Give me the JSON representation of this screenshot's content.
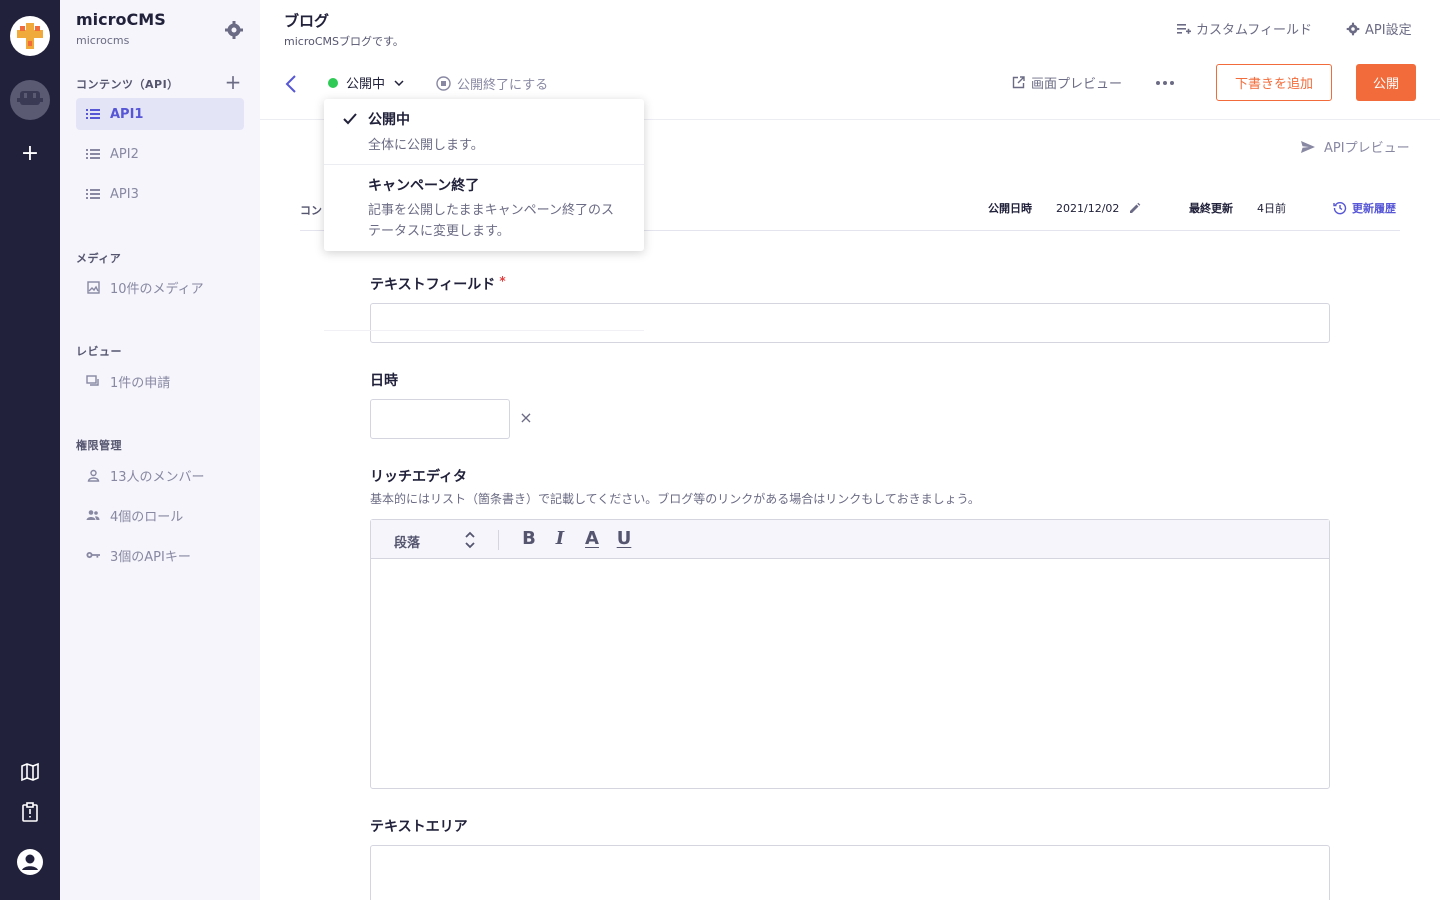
{
  "app": {
    "name": "microCMS",
    "service_id": "microcms"
  },
  "sidebar": {
    "sections": {
      "content": "コンテンツ（API）",
      "media": "メディア",
      "review": "レビュー",
      "permissions": "権限管理"
    },
    "content_items": [
      {
        "label": "API1",
        "active": true
      },
      {
        "label": "API2",
        "active": false
      },
      {
        "label": "API3",
        "active": false
      }
    ],
    "media_item": "10件のメディア",
    "review_item": "1件の申請",
    "permission_items": [
      "13人のメンバー",
      "4個のロール",
      "3個のAPIキー"
    ]
  },
  "header": {
    "title": "ブログ",
    "description": "microCMSブログです。",
    "custom_field": "カスタムフィールド",
    "api_settings": "API設定"
  },
  "toolbar": {
    "status": "公開中",
    "unpublish": "公開終了にする",
    "screen_preview": "画面プレビュー",
    "add_draft": "下書きを追加",
    "publish": "公開"
  },
  "api_preview": "APIプレビュー",
  "meta": {
    "left_label": "コン",
    "published_label": "公開日時",
    "published_value": "2021/12/02",
    "updated_label": "最終更新",
    "updated_value": "4日前",
    "history": "更新履歴"
  },
  "fields": {
    "text_field": {
      "label": "テキストフィールド",
      "required_mark": "*",
      "value": ""
    },
    "datetime": {
      "label": "日時",
      "value": "",
      "clear": "×"
    },
    "rich_editor": {
      "label": "リッチエディタ",
      "hint": "基本的にはリスト（箇条書き）で記載してください。ブログ等のリンクがある場合はリンクもしておきましょう。",
      "block_type": "段落",
      "format_buttons": [
        "B",
        "I",
        "A",
        "U"
      ]
    },
    "textarea": {
      "label": "テキストエリア",
      "value": ""
    }
  },
  "status_dropdown": {
    "options": [
      {
        "title": "公開中",
        "description": "全体に公開します。",
        "selected": true
      },
      {
        "title": "キャンペーン終了",
        "description": "記事を公開したままキャンペーン終了のステータスに変更します。",
        "selected": false
      }
    ]
  },
  "colors": {
    "rail_bg": "#21213b",
    "sidebar_bg": "#f5f5fb",
    "accent": "#f26b3a",
    "active_text": "#5656d6",
    "status_green": "#2fc956"
  }
}
